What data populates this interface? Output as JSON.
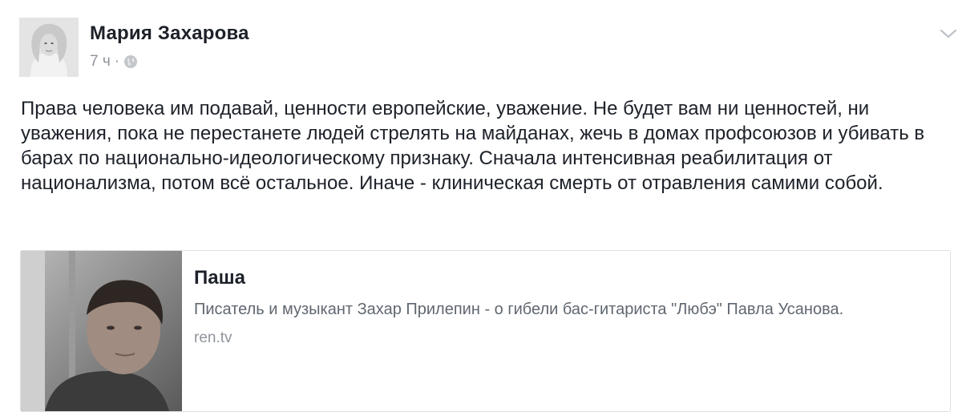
{
  "post": {
    "author": "Мария Захарова",
    "time": "7 ч",
    "separator": "·",
    "privacy_icon": "globe-icon",
    "menu_icon": "chevron-down-icon",
    "text": "Права человека им подавай, ценности европейские, уважение. Не будет вам ни ценностей, ни уважения, пока не перестанете людей стрелять на майданах, жечь в домах профсоюзов и убивать в барах по национально-идеологическому признаку. Сначала интенсивная реабилитация от национализма, потом всё остальное. Иначе - клиническая смерть от отравления самими собой."
  },
  "link": {
    "title": "Паша",
    "description": "Писатель и музыкант Захар Прилепин - о гибели бас-гитариста \"Любэ\" Павла Усанова.",
    "domain": "ren.tv"
  },
  "colors": {
    "text": "#1d2129",
    "meta": "#90949c",
    "description": "#606770",
    "border": "#dddfe2"
  }
}
